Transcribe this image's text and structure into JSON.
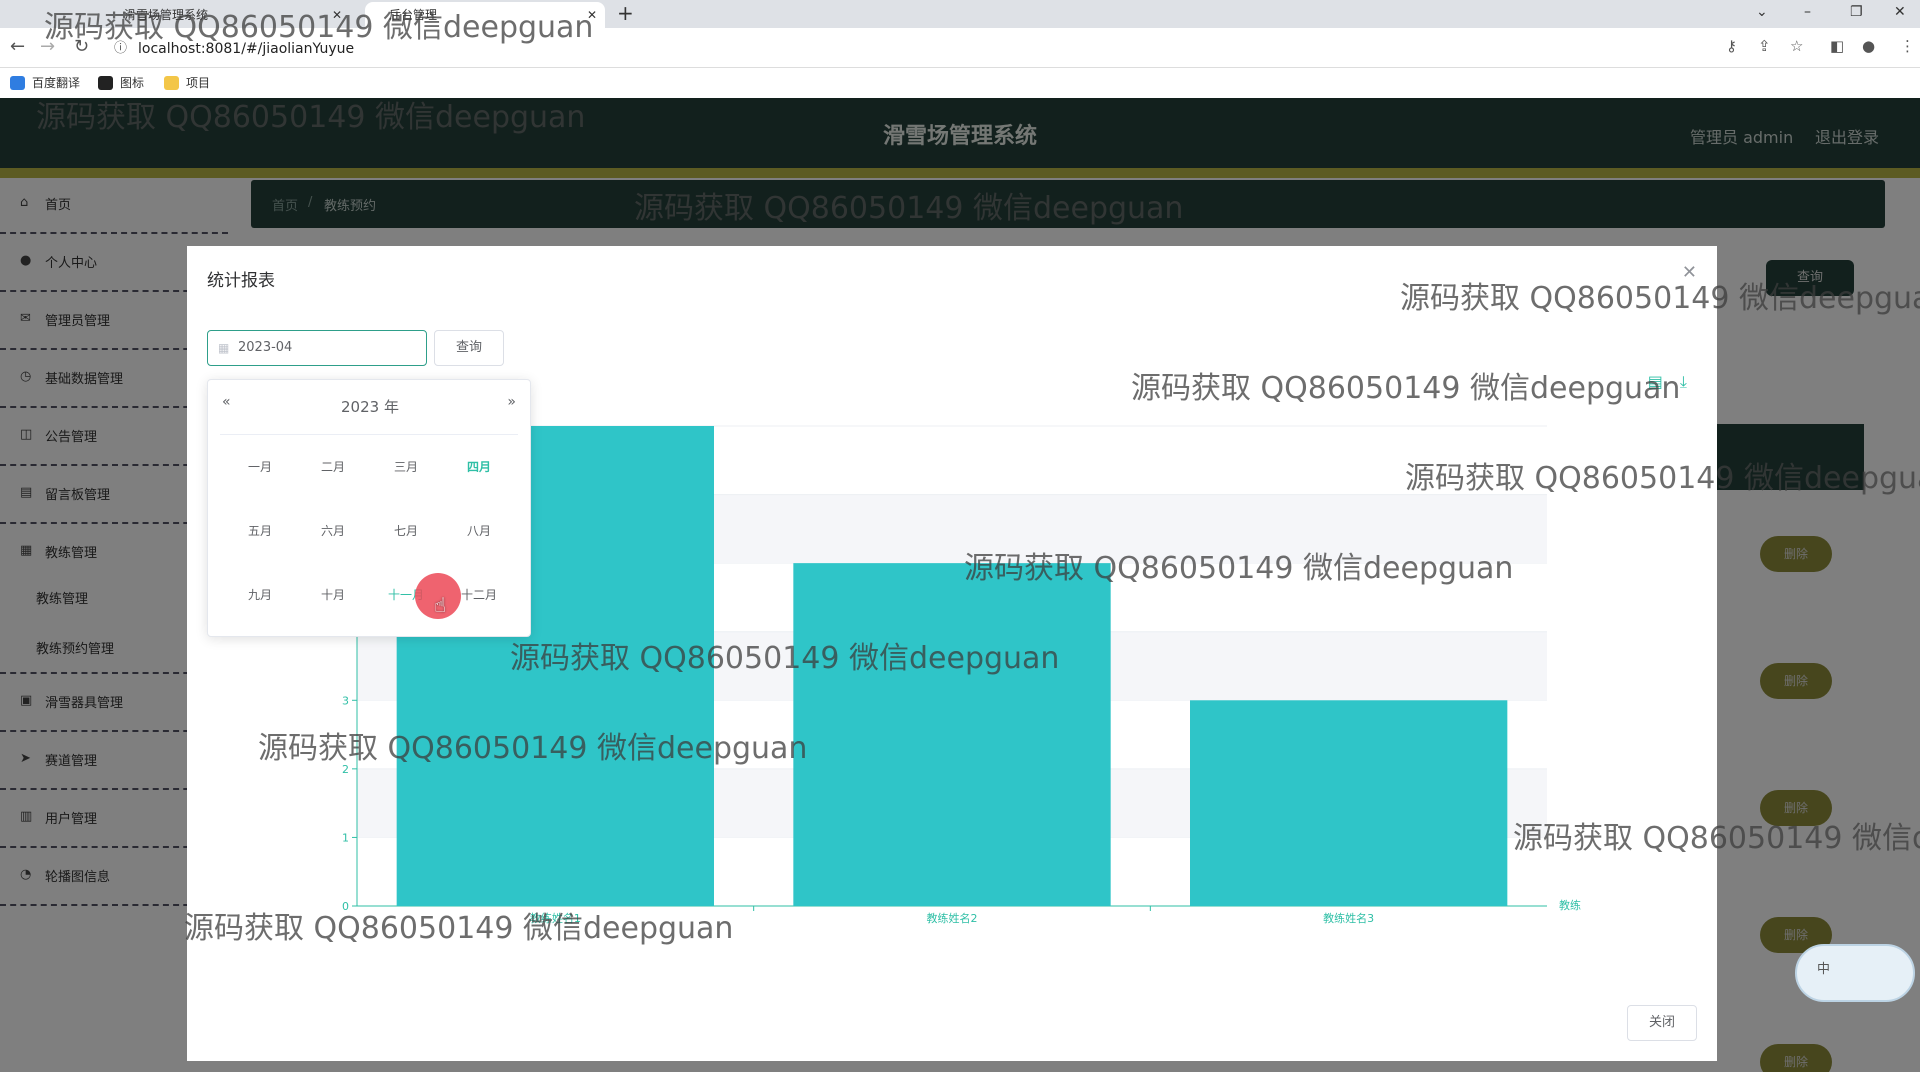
{
  "browser": {
    "tabs": [
      {
        "title": "滑雪场管理系统"
      },
      {
        "title": "后台管理"
      }
    ],
    "url": "localhost:8081/#/jiaolianYuyue",
    "bookmarks": [
      "百度翻译",
      "图标",
      "项目"
    ]
  },
  "app": {
    "title": "滑雪场管理系统",
    "user_label": "管理员 admin",
    "logout": "退出登录"
  },
  "sidebar": {
    "items": [
      {
        "label": "首页",
        "icon": "home-icon"
      },
      {
        "label": "个人中心",
        "icon": "user-icon"
      },
      {
        "label": "管理员管理",
        "icon": "mail-icon"
      },
      {
        "label": "基础数据管理",
        "icon": "clock-icon"
      },
      {
        "label": "公告管理",
        "icon": "notice-icon"
      },
      {
        "label": "留言板管理",
        "icon": "board-icon"
      },
      {
        "label": "教练管理",
        "icon": "coach-icon"
      },
      {
        "label": "滑雪器具管理",
        "icon": "equipment-icon"
      },
      {
        "label": "赛道管理",
        "icon": "send-icon"
      },
      {
        "label": "用户管理",
        "icon": "users-icon"
      },
      {
        "label": "轮播图信息",
        "icon": "carousel-icon"
      }
    ],
    "sub_items": [
      "教练管理",
      "教练预约管理"
    ]
  },
  "breadcrumb": {
    "home": "首页",
    "sep": "/",
    "current": "教练预约"
  },
  "background": {
    "query_button": "查询",
    "delete_label": "删除"
  },
  "dialog": {
    "title": "统计报表",
    "date_value": "2023-04",
    "query_button": "查询",
    "close_button": "关闭"
  },
  "picker": {
    "year_label": "2023 年",
    "months": [
      "一月",
      "二月",
      "三月",
      "四月",
      "五月",
      "六月",
      "七月",
      "八月",
      "九月",
      "十月",
      "十一月",
      "十二月"
    ],
    "current_month_index": 3,
    "hover_month_index": 10
  },
  "chart_data": {
    "type": "bar",
    "categories": [
      "教练姓名1",
      "教练姓名2",
      "教练姓名3"
    ],
    "values": [
      7,
      5,
      3
    ],
    "xlabel": "教练",
    "ylabel": "",
    "ylim": [
      0,
      7
    ],
    "yticks": [
      0,
      1,
      2,
      3
    ],
    "grid": true,
    "color": "#2fc5c8"
  },
  "watermark": "源码获取 QQ86050149 微信deepguan",
  "ime_label": "中"
}
